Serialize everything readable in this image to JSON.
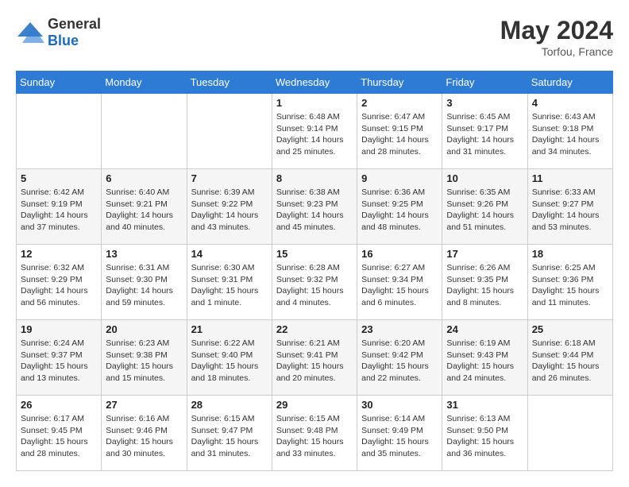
{
  "header": {
    "logo_general": "General",
    "logo_blue": "Blue",
    "month_year": "May 2024",
    "location": "Torfou, France"
  },
  "days_of_week": [
    "Sunday",
    "Monday",
    "Tuesday",
    "Wednesday",
    "Thursday",
    "Friday",
    "Saturday"
  ],
  "weeks": [
    [
      {
        "day": "",
        "sunrise": "",
        "sunset": "",
        "daylight": ""
      },
      {
        "day": "",
        "sunrise": "",
        "sunset": "",
        "daylight": ""
      },
      {
        "day": "",
        "sunrise": "",
        "sunset": "",
        "daylight": ""
      },
      {
        "day": "1",
        "sunrise": "Sunrise: 6:48 AM",
        "sunset": "Sunset: 9:14 PM",
        "daylight": "Daylight: 14 hours and 25 minutes."
      },
      {
        "day": "2",
        "sunrise": "Sunrise: 6:47 AM",
        "sunset": "Sunset: 9:15 PM",
        "daylight": "Daylight: 14 hours and 28 minutes."
      },
      {
        "day": "3",
        "sunrise": "Sunrise: 6:45 AM",
        "sunset": "Sunset: 9:17 PM",
        "daylight": "Daylight: 14 hours and 31 minutes."
      },
      {
        "day": "4",
        "sunrise": "Sunrise: 6:43 AM",
        "sunset": "Sunset: 9:18 PM",
        "daylight": "Daylight: 14 hours and 34 minutes."
      }
    ],
    [
      {
        "day": "5",
        "sunrise": "Sunrise: 6:42 AM",
        "sunset": "Sunset: 9:19 PM",
        "daylight": "Daylight: 14 hours and 37 minutes."
      },
      {
        "day": "6",
        "sunrise": "Sunrise: 6:40 AM",
        "sunset": "Sunset: 9:21 PM",
        "daylight": "Daylight: 14 hours and 40 minutes."
      },
      {
        "day": "7",
        "sunrise": "Sunrise: 6:39 AM",
        "sunset": "Sunset: 9:22 PM",
        "daylight": "Daylight: 14 hours and 43 minutes."
      },
      {
        "day": "8",
        "sunrise": "Sunrise: 6:38 AM",
        "sunset": "Sunset: 9:23 PM",
        "daylight": "Daylight: 14 hours and 45 minutes."
      },
      {
        "day": "9",
        "sunrise": "Sunrise: 6:36 AM",
        "sunset": "Sunset: 9:25 PM",
        "daylight": "Daylight: 14 hours and 48 minutes."
      },
      {
        "day": "10",
        "sunrise": "Sunrise: 6:35 AM",
        "sunset": "Sunset: 9:26 PM",
        "daylight": "Daylight: 14 hours and 51 minutes."
      },
      {
        "day": "11",
        "sunrise": "Sunrise: 6:33 AM",
        "sunset": "Sunset: 9:27 PM",
        "daylight": "Daylight: 14 hours and 53 minutes."
      }
    ],
    [
      {
        "day": "12",
        "sunrise": "Sunrise: 6:32 AM",
        "sunset": "Sunset: 9:29 PM",
        "daylight": "Daylight: 14 hours and 56 minutes."
      },
      {
        "day": "13",
        "sunrise": "Sunrise: 6:31 AM",
        "sunset": "Sunset: 9:30 PM",
        "daylight": "Daylight: 14 hours and 59 minutes."
      },
      {
        "day": "14",
        "sunrise": "Sunrise: 6:30 AM",
        "sunset": "Sunset: 9:31 PM",
        "daylight": "Daylight: 15 hours and 1 minute."
      },
      {
        "day": "15",
        "sunrise": "Sunrise: 6:28 AM",
        "sunset": "Sunset: 9:32 PM",
        "daylight": "Daylight: 15 hours and 4 minutes."
      },
      {
        "day": "16",
        "sunrise": "Sunrise: 6:27 AM",
        "sunset": "Sunset: 9:34 PM",
        "daylight": "Daylight: 15 hours and 6 minutes."
      },
      {
        "day": "17",
        "sunrise": "Sunrise: 6:26 AM",
        "sunset": "Sunset: 9:35 PM",
        "daylight": "Daylight: 15 hours and 8 minutes."
      },
      {
        "day": "18",
        "sunrise": "Sunrise: 6:25 AM",
        "sunset": "Sunset: 9:36 PM",
        "daylight": "Daylight: 15 hours and 11 minutes."
      }
    ],
    [
      {
        "day": "19",
        "sunrise": "Sunrise: 6:24 AM",
        "sunset": "Sunset: 9:37 PM",
        "daylight": "Daylight: 15 hours and 13 minutes."
      },
      {
        "day": "20",
        "sunrise": "Sunrise: 6:23 AM",
        "sunset": "Sunset: 9:38 PM",
        "daylight": "Daylight: 15 hours and 15 minutes."
      },
      {
        "day": "21",
        "sunrise": "Sunrise: 6:22 AM",
        "sunset": "Sunset: 9:40 PM",
        "daylight": "Daylight: 15 hours and 18 minutes."
      },
      {
        "day": "22",
        "sunrise": "Sunrise: 6:21 AM",
        "sunset": "Sunset: 9:41 PM",
        "daylight": "Daylight: 15 hours and 20 minutes."
      },
      {
        "day": "23",
        "sunrise": "Sunrise: 6:20 AM",
        "sunset": "Sunset: 9:42 PM",
        "daylight": "Daylight: 15 hours and 22 minutes."
      },
      {
        "day": "24",
        "sunrise": "Sunrise: 6:19 AM",
        "sunset": "Sunset: 9:43 PM",
        "daylight": "Daylight: 15 hours and 24 minutes."
      },
      {
        "day": "25",
        "sunrise": "Sunrise: 6:18 AM",
        "sunset": "Sunset: 9:44 PM",
        "daylight": "Daylight: 15 hours and 26 minutes."
      }
    ],
    [
      {
        "day": "26",
        "sunrise": "Sunrise: 6:17 AM",
        "sunset": "Sunset: 9:45 PM",
        "daylight": "Daylight: 15 hours and 28 minutes."
      },
      {
        "day": "27",
        "sunrise": "Sunrise: 6:16 AM",
        "sunset": "Sunset: 9:46 PM",
        "daylight": "Daylight: 15 hours and 30 minutes."
      },
      {
        "day": "28",
        "sunrise": "Sunrise: 6:15 AM",
        "sunset": "Sunset: 9:47 PM",
        "daylight": "Daylight: 15 hours and 31 minutes."
      },
      {
        "day": "29",
        "sunrise": "Sunrise: 6:15 AM",
        "sunset": "Sunset: 9:48 PM",
        "daylight": "Daylight: 15 hours and 33 minutes."
      },
      {
        "day": "30",
        "sunrise": "Sunrise: 6:14 AM",
        "sunset": "Sunset: 9:49 PM",
        "daylight": "Daylight: 15 hours and 35 minutes."
      },
      {
        "day": "31",
        "sunrise": "Sunrise: 6:13 AM",
        "sunset": "Sunset: 9:50 PM",
        "daylight": "Daylight: 15 hours and 36 minutes."
      },
      {
        "day": "",
        "sunrise": "",
        "sunset": "",
        "daylight": ""
      }
    ]
  ]
}
